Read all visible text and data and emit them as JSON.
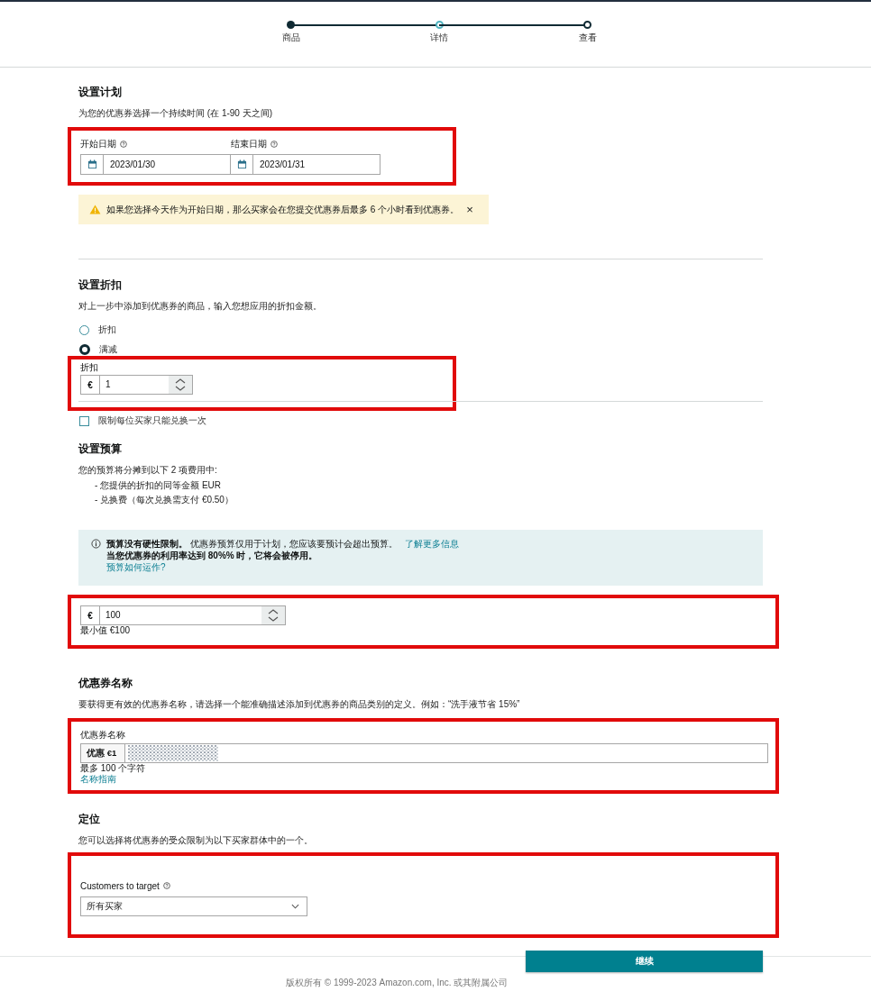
{
  "stepper": [
    {
      "label": "商品",
      "completed": true,
      "current": false
    },
    {
      "label": "详情",
      "completed": false,
      "current": true
    },
    {
      "label": "查看",
      "completed": false,
      "current": false
    }
  ],
  "schedule": {
    "title": "设置计划",
    "description": "为您的优惠券选择一个持续时间 (在 1-90 天之间)",
    "highlighted": true,
    "dates": [
      {
        "label": "开始日期",
        "value": "2023/01/30"
      },
      {
        "label": "结束日期",
        "value": "2023/01/31"
      }
    ],
    "warning": {
      "text": "如果您选择今天作为开始日期，那么买家会在您提交优惠券后最多 6 个小时看到优惠券。",
      "close": "×"
    }
  },
  "discount": {
    "title": "设置折扣",
    "description": "对上一步中添加到优惠券的商品，输入您想应用的折扣金额。",
    "options": [
      {
        "label": "折扣",
        "selected": false
      },
      {
        "label": "满减",
        "selected": true
      }
    ],
    "amount": {
      "label": "折扣",
      "currency": "€",
      "value": "1",
      "highlighted": true
    },
    "limit": {
      "label": "限制每位买家只能兑换一次",
      "checked": false
    }
  },
  "budget": {
    "title": "设置预算",
    "intro": "您的预算将分摊到以下 2 项费用中:",
    "items": [
      "- 您提供的折扣的同等金额 EUR",
      "- 兑换费（每次兑换需支付 €0.50）"
    ],
    "notice": {
      "text": "**预算没有硬性限制。** 优惠券预算仅用于计划，您应该要预计会超出预算。",
      "link": "了解更多信息",
      "line2": "当您优惠券的利用率达到 80%% 时，它将会被停用。",
      "link2": "预算如何运作?"
    },
    "amount": {
      "currency": "€",
      "value": "100",
      "hint": "最小值 €100",
      "highlighted": true
    }
  },
  "coupon_name": {
    "title": "优惠券名称",
    "description": "要获得更有效的优惠券名称，请选择一个能准确描述添加到优惠券的商品类别的定义。例如：“洗手液节省 15%”",
    "highlighted": true,
    "label": "优惠券名称",
    "prefix": "优惠 €1",
    "hint": "最多 100 个字符",
    "link": "名称指南"
  },
  "targeting": {
    "title": "定位",
    "description": "您可以选择将优惠券的受众限制为以下买家群体中的一个。",
    "highlighted": true,
    "label": "Customers to target",
    "value": "所有买家"
  },
  "footer": {
    "button": "继续",
    "copyright": "版权所有 © 1999-2023 Amazon.com, Inc. 或其附属公司"
  }
}
